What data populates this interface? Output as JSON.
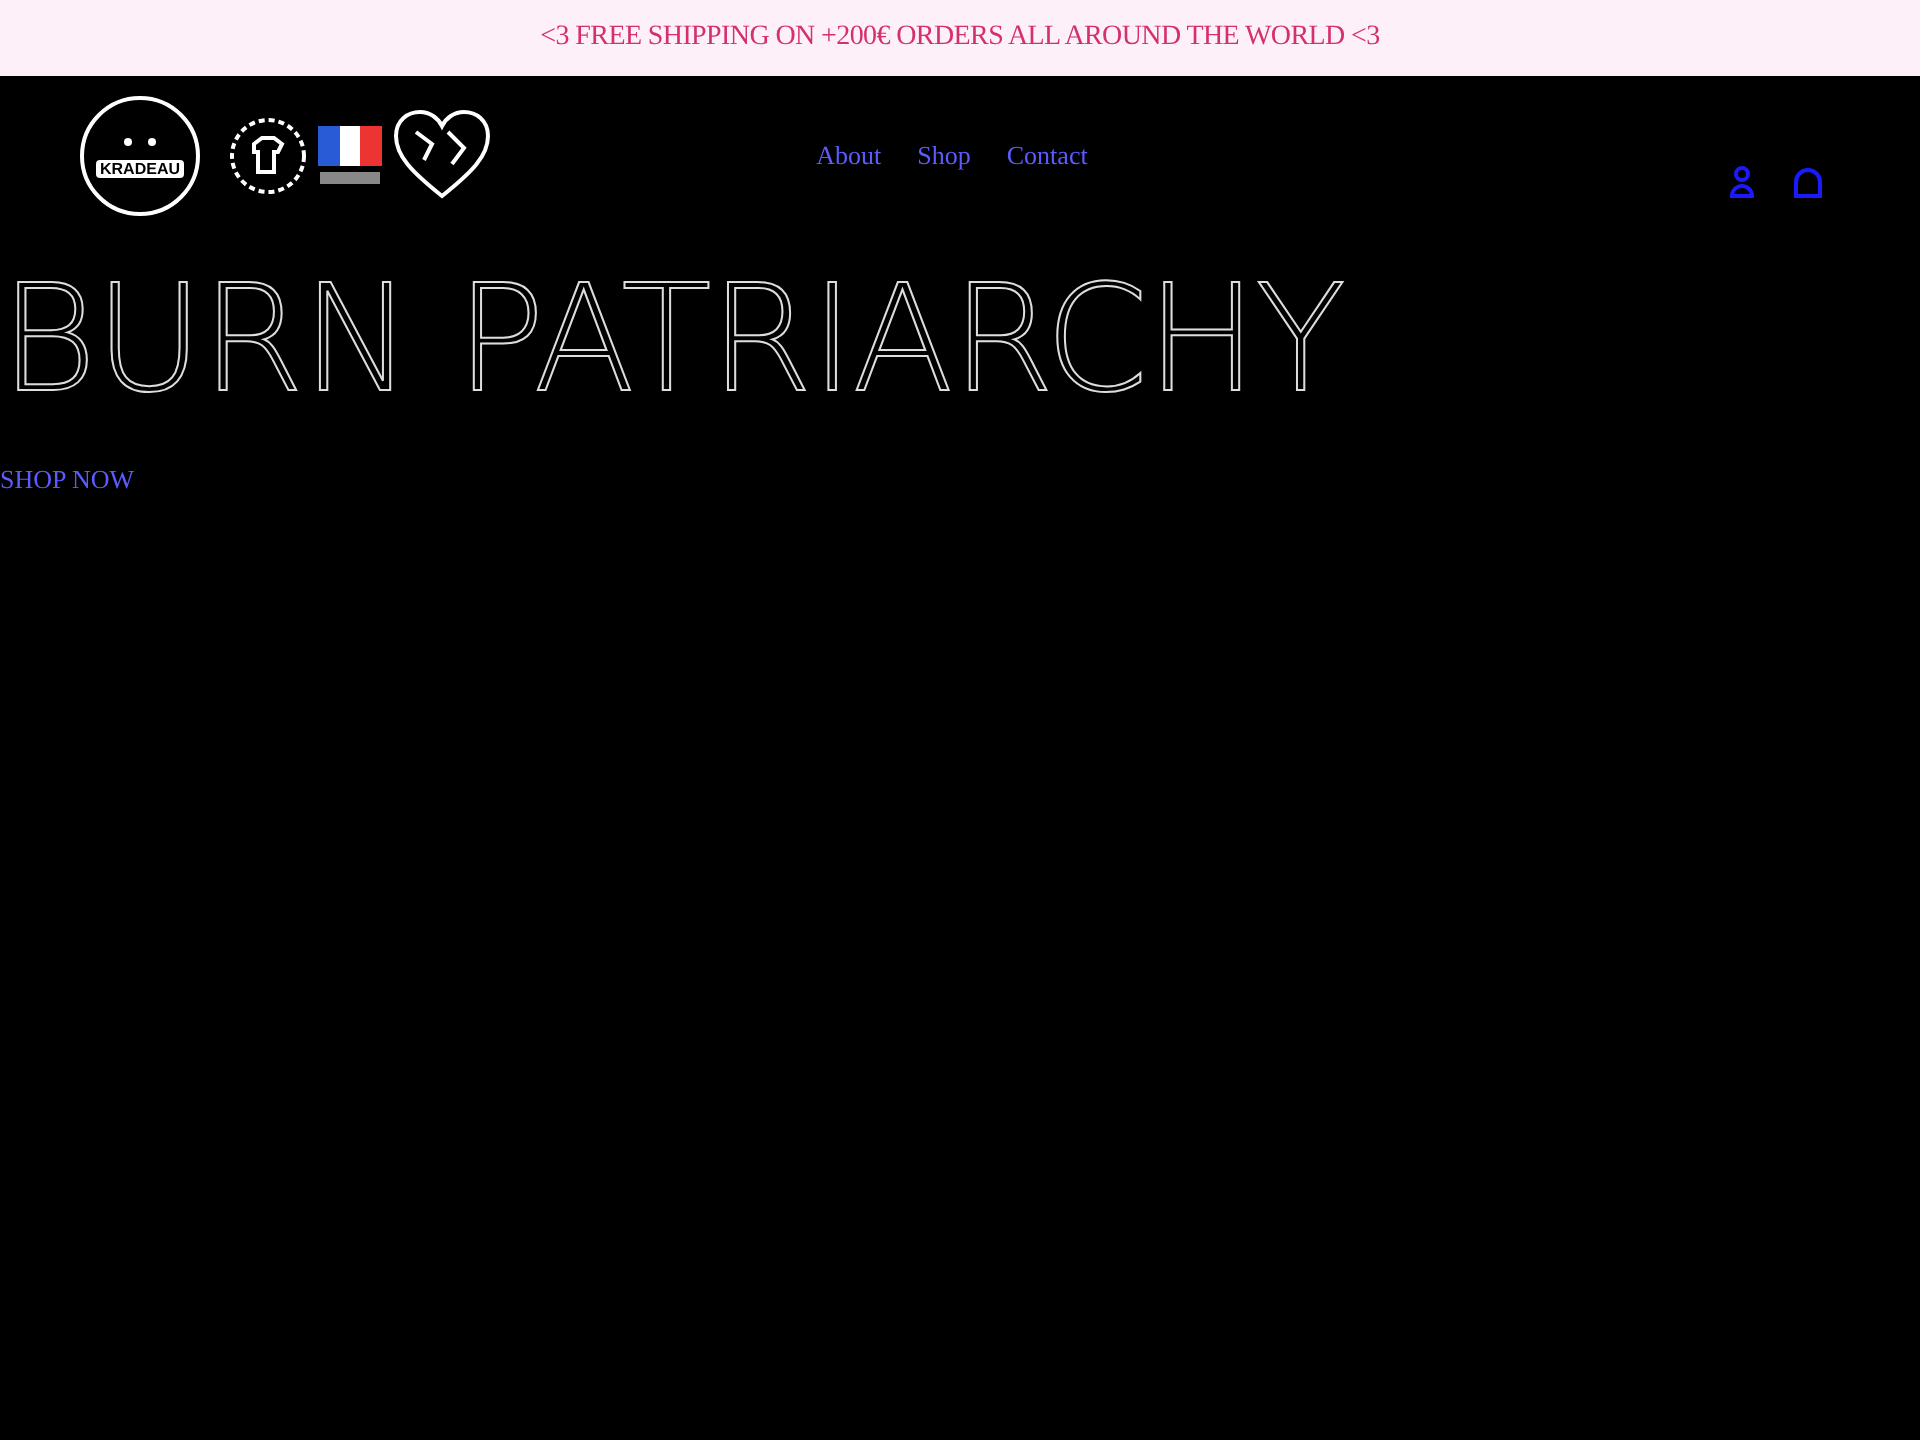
{
  "announcement": "<3 FREE SHIPPING ON +200€ ORDERS ALL AROUND THE WORLD <3",
  "logo": {
    "text": "KRADEAU"
  },
  "nav": [
    {
      "label": "About"
    },
    {
      "label": "Shop"
    },
    {
      "label": "Contact"
    }
  ],
  "hero": {
    "title": "BURN PATRIARCHY",
    "link": "SHOP NOW"
  }
}
